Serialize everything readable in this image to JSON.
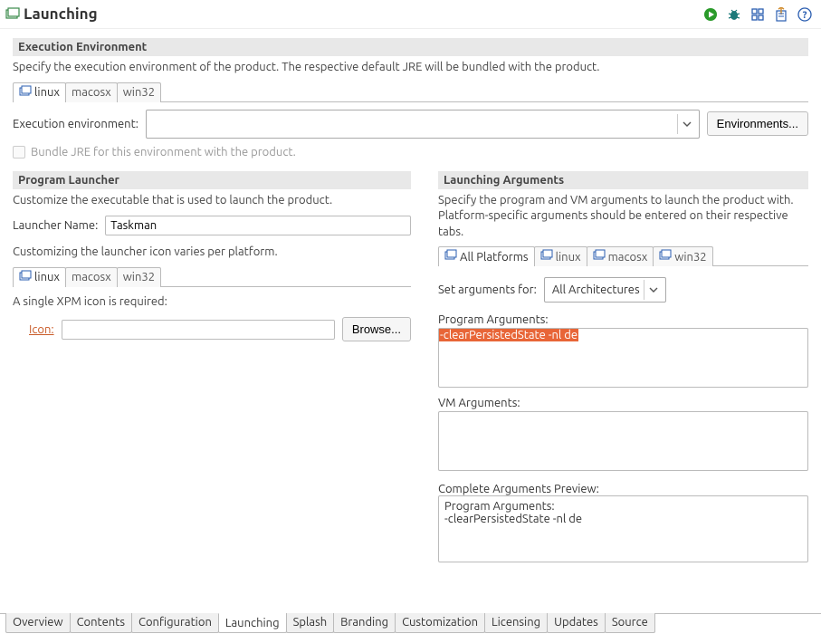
{
  "header": {
    "title": "Launching"
  },
  "execEnv": {
    "title": "Execution Environment",
    "desc": "Specify the execution environment of the product. The respective default JRE will be bundled with the product.",
    "tabs": [
      "linux",
      "macosx",
      "win32"
    ],
    "label": "Execution environment:",
    "value": "",
    "environmentsBtn": "Environments...",
    "bundleJre": "Bundle JRE for this environment with the product."
  },
  "programLauncher": {
    "title": "Program Launcher",
    "desc": "Customize the executable that is used to launch the product.",
    "nameLabel": "Launcher Name:",
    "nameValue": "Taskman",
    "customizeNote": "Customizing the launcher icon varies per platform.",
    "tabs": [
      "linux",
      "macosx",
      "win32"
    ],
    "xpmNote": "A single XPM icon is required:",
    "iconLabel": "Icon:",
    "iconValue": "",
    "browseBtn": "Browse..."
  },
  "launchingArgs": {
    "title": "Launching Arguments",
    "desc": "Specify the program and VM arguments to launch the product with.  Platform-specific arguments should be entered on their respective tabs.",
    "tabs": [
      "All Platforms",
      "linux",
      "macosx",
      "win32"
    ],
    "setArgsLabel": "Set arguments for:",
    "setArgsValue": "All Architectures",
    "programArgsLabel": "Program Arguments:",
    "programArgsValue": "-clearPersistedState -nl de",
    "vmArgsLabel": "VM Arguments:",
    "vmArgsValue": "",
    "previewLabel": "Complete Arguments Preview:",
    "previewLine1": "Program Arguments:",
    "previewLine2": "-clearPersistedState -nl de"
  },
  "bottomTabs": [
    "Overview",
    "Contents",
    "Configuration",
    "Launching",
    "Splash",
    "Branding",
    "Customization",
    "Licensing",
    "Updates",
    "Source"
  ],
  "bottomActive": "Launching"
}
